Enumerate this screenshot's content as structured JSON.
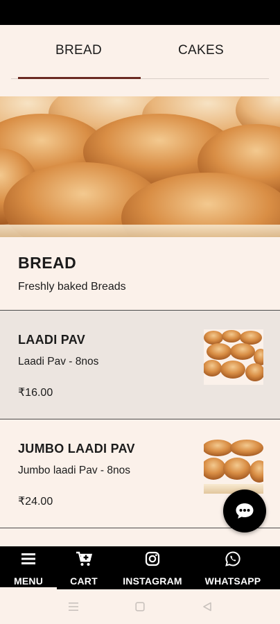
{
  "tabs": [
    {
      "label": "BREAD",
      "active": true
    },
    {
      "label": "CAKES",
      "active": false
    }
  ],
  "section": {
    "title": "BREAD",
    "subtitle": "Freshly baked Breads"
  },
  "items": [
    {
      "name": "LAADI PAV",
      "description": "Laadi Pav - 8nos",
      "price": "₹16.00"
    },
    {
      "name": "JUMBO LAADI PAV",
      "description": "Jumbo laadi Pav - 8nos",
      "price": "₹24.00"
    }
  ],
  "bottom_nav": [
    {
      "label": "MENU",
      "icon": "menu-icon",
      "active": true
    },
    {
      "label": "CART",
      "icon": "cart-icon",
      "active": false
    },
    {
      "label": "INSTAGRAM",
      "icon": "instagram-icon",
      "active": false
    },
    {
      "label": "WHATSAPP",
      "icon": "whatsapp-icon",
      "active": false
    }
  ],
  "colors": {
    "background": "#fbf1ea",
    "tab_indicator": "#6b2a22",
    "nav_background": "#000000",
    "selected_item_background": "#ece5e0"
  }
}
